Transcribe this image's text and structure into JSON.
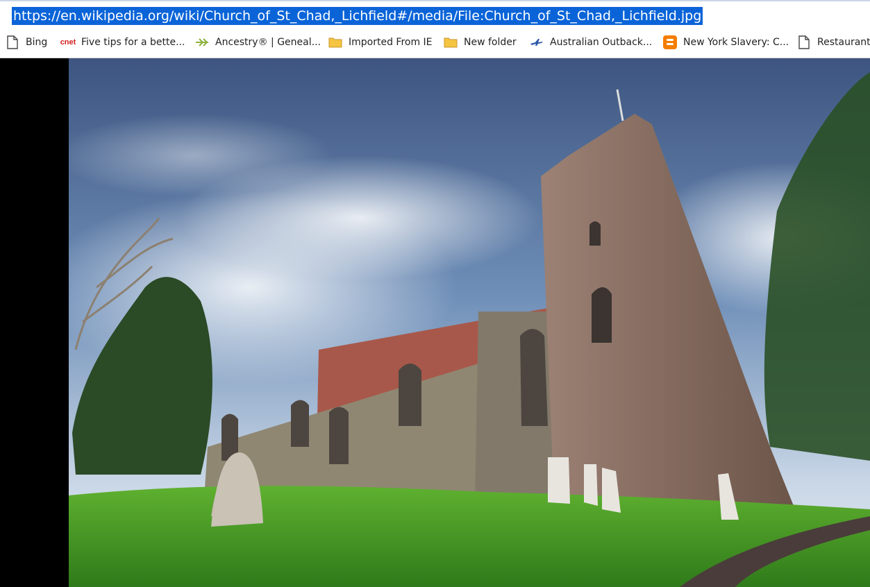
{
  "address_bar": {
    "url": "https://en.wikipedia.org/wiki/Church_of_St_Chad,_Lichfield#/media/File:Church_of_St_Chad,_Lichfield.jpg"
  },
  "bookmarks": [
    {
      "label": "Bing",
      "icon": "page-icon"
    },
    {
      "label": "Five tips for a bette...",
      "icon": "cnet-icon",
      "icon_text": "cnet"
    },
    {
      "label": "Ancestry® | Geneal...",
      "icon": "ancestry-leaf-icon"
    },
    {
      "label": "Imported From IE",
      "icon": "folder-icon"
    },
    {
      "label": "New folder",
      "icon": "folder-icon"
    },
    {
      "label": "Australian Outback...",
      "icon": "plane-icon"
    },
    {
      "label": "New York Slavery: C...",
      "icon": "blogger-icon"
    },
    {
      "label": "Restaurants",
      "icon": "page-icon"
    }
  ],
  "viewer": {
    "image_file": "File:Church_of_St_Chad,_Lichfield.jpg"
  },
  "colors": {
    "selection": "#0a64d8",
    "folder": "#f5c542",
    "cnet_red": "#d41f1f",
    "blogger_orange": "#f57d00",
    "ancestry_green": "#8cb23b",
    "sky": "#4e6c97",
    "grass": "#4a9a24",
    "stone": "#7a6356"
  }
}
